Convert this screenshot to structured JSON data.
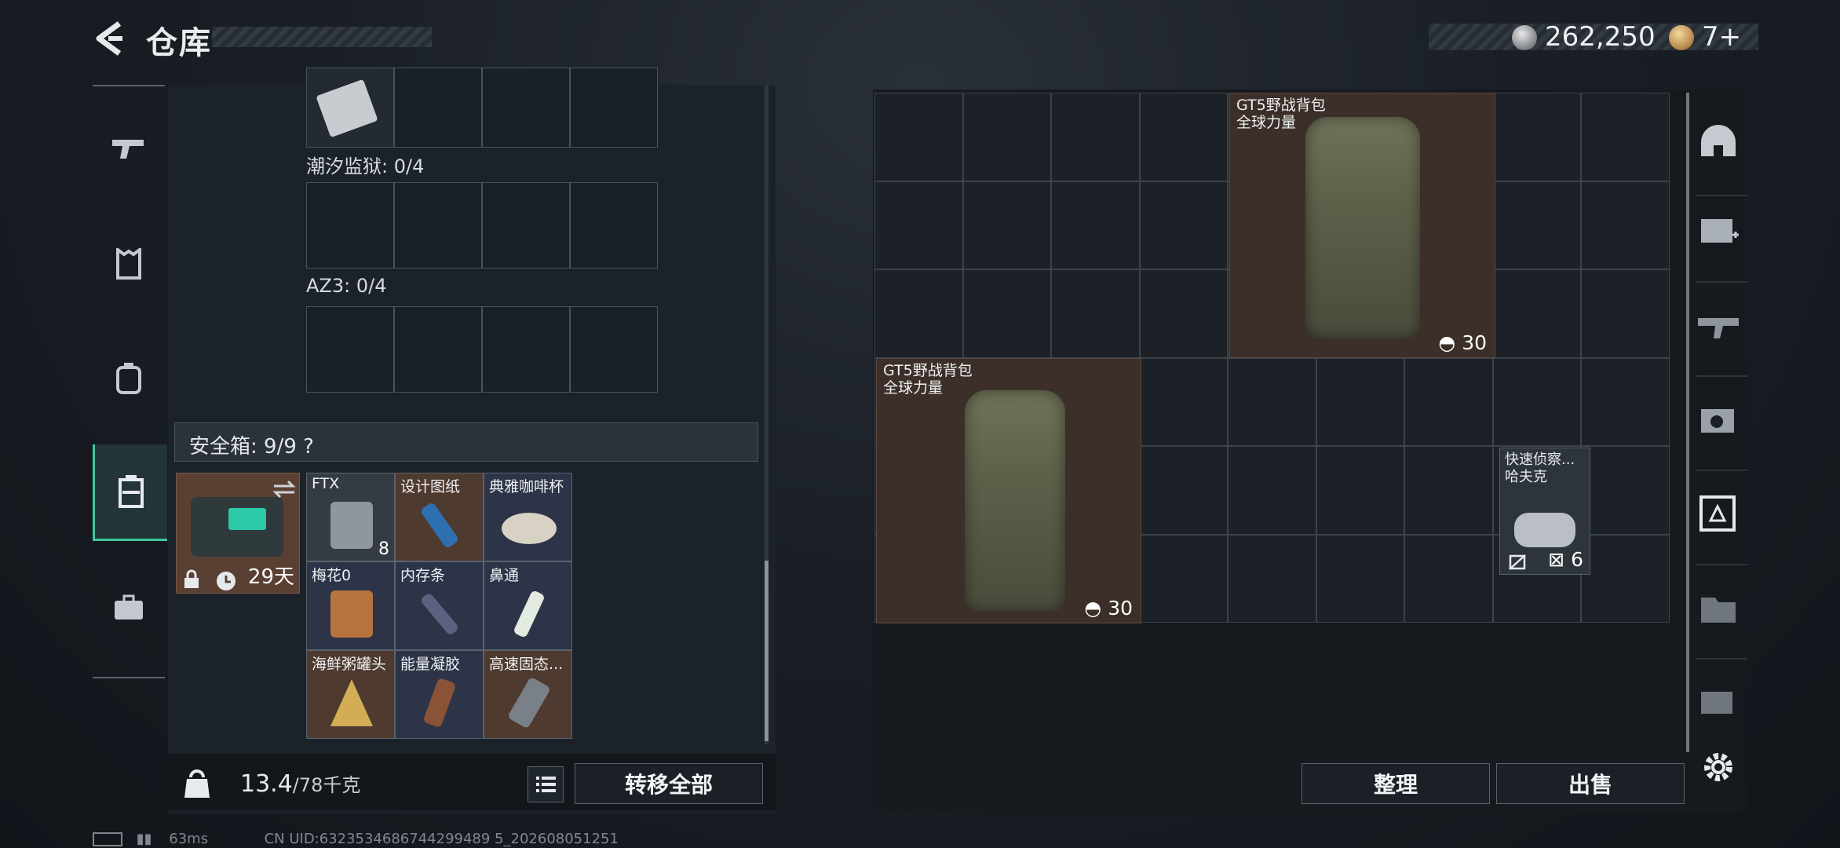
{
  "header": {
    "title": "仓库",
    "currency_value": "262,250",
    "level_value": "7+"
  },
  "left_rail": {
    "items": [
      {
        "icon": "pistol-icon"
      },
      {
        "icon": "armor-vest-icon"
      },
      {
        "icon": "backpack-icon"
      },
      {
        "icon": "secure-case-icon",
        "active": true
      },
      {
        "icon": "briefcase-icon"
      }
    ]
  },
  "left_panel": {
    "sections": [
      {
        "label": "潮汐监狱: 0/4"
      },
      {
        "label": "AZ3: 0/4"
      }
    ],
    "safe_header": "安全箱: 9/9 ?",
    "safe_box_days": "29天",
    "safe_items": [
      {
        "name": "FTX",
        "count": "8",
        "color": "#3d4450"
      },
      {
        "name": "设计图纸",
        "count": "",
        "color": "#2e5a8a"
      },
      {
        "name": "典雅咖啡杯",
        "count": "",
        "color": "#c9c0b0"
      },
      {
        "name": "梅花0",
        "count": "",
        "color": "#8b5a3a"
      },
      {
        "name": "内存条",
        "count": "",
        "color": "#4a5070"
      },
      {
        "name": "鼻通",
        "count": "",
        "color": "#dfe7e0"
      },
      {
        "name": "海鲜粥罐头",
        "count": "",
        "color": "#c9a64a"
      },
      {
        "name": "能量凝胶",
        "count": "",
        "color": "#7a4a33"
      },
      {
        "name": "高速固态...",
        "count": "",
        "color": "#6a6f75"
      }
    ],
    "weight_current": "13.4",
    "weight_max": "/78千克",
    "transfer_all": "转移全部"
  },
  "right_panel": {
    "bag_top": {
      "name": "GT5野战背包",
      "brand": "全球力量",
      "capacity": "30"
    },
    "bag_left": {
      "name": "GT5野战背包",
      "brand": "全球力量",
      "capacity": "30"
    },
    "duffel": {
      "name": "快速侦察...",
      "brand": "哈夫克",
      "capacity": "6"
    },
    "sort_button": "整理",
    "sell_button": "出售"
  },
  "right_rail": {
    "icons": [
      "helmet-icon",
      "medkit-icon",
      "rifle-icon",
      "armor-icon",
      "safe-icon",
      "folder-icon",
      "key-icon",
      "settings-icon"
    ]
  },
  "status_bar": {
    "ping": "63ms",
    "uid": "CN UID:6323534686744299489 5_202608051251"
  }
}
